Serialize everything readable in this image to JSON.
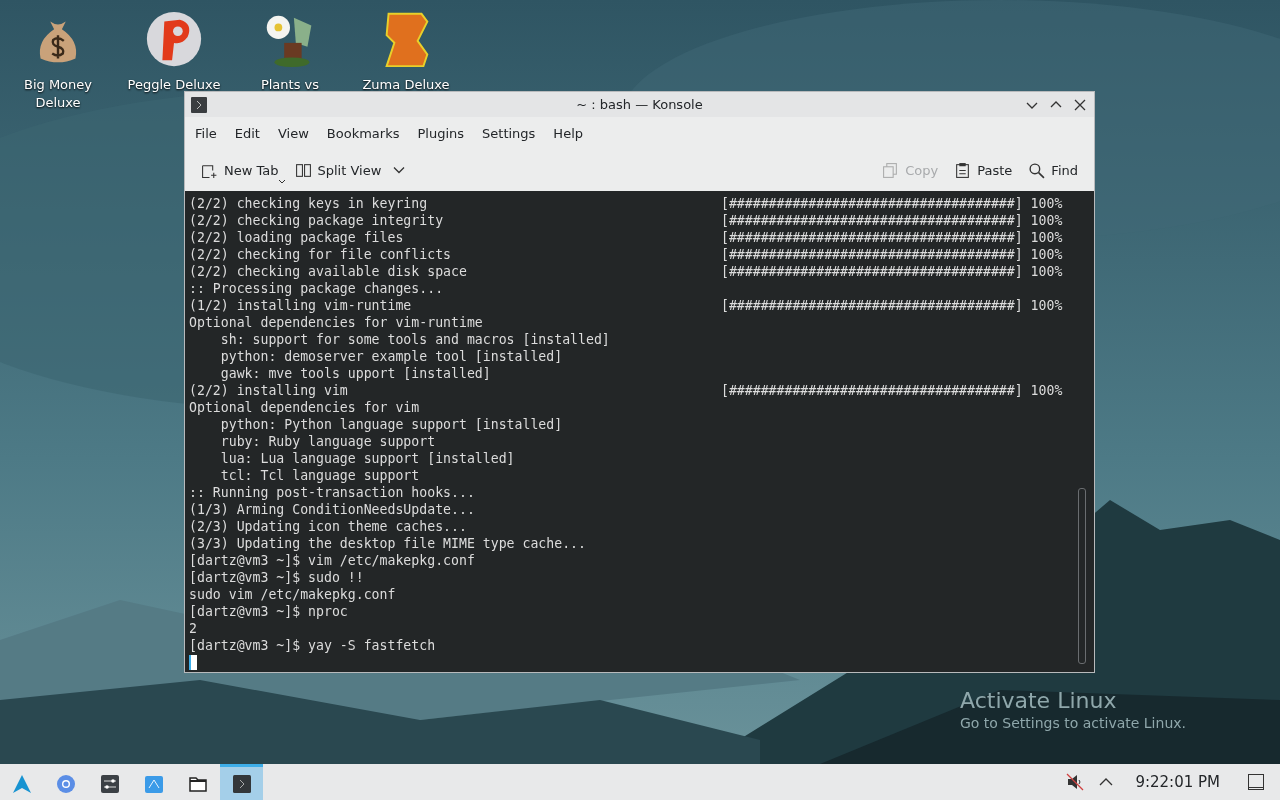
{
  "desktop_icons": [
    {
      "label": "Big Money Deluxe",
      "kind": "moneybag"
    },
    {
      "label": "Peggle Deluxe",
      "kind": "ball"
    },
    {
      "label": "Plants vs",
      "kind": "flower"
    },
    {
      "label": "Zuma Deluxe",
      "kind": "block"
    }
  ],
  "window": {
    "title": "~ : bash — Konsole",
    "menu": [
      "File",
      "Edit",
      "View",
      "Bookmarks",
      "Plugins",
      "Settings",
      "Help"
    ],
    "toolbar": [
      {
        "label": "New Tab",
        "kind": "new-tab",
        "disabled": false
      },
      {
        "label": "Split View",
        "kind": "split",
        "disabled": false
      },
      {
        "label": "Copy",
        "kind": "copy",
        "disabled": true
      },
      {
        "label": "Paste",
        "kind": "paste",
        "disabled": false
      },
      {
        "label": "Find",
        "kind": "find",
        "disabled": false
      }
    ],
    "terminal": {
      "lines": [
        {
          "text": "(2/2) checking keys in keyring",
          "progress": "[####################################] 100%"
        },
        {
          "text": "(2/2) checking package integrity",
          "progress": "[####################################] 100%"
        },
        {
          "text": "(2/2) loading package files",
          "progress": "[####################################] 100%"
        },
        {
          "text": "(2/2) checking for file conflicts",
          "progress": "[####################################] 100%"
        },
        {
          "text": "(2/2) checking available disk space",
          "progress": "[####################################] 100%"
        },
        {
          "text": ":: Processing package changes..."
        },
        {
          "text": "(1/2) installing vim-runtime",
          "progress": "[####################################] 100%"
        },
        {
          "text": "Optional dependencies for vim-runtime"
        },
        {
          "text": "    sh: support for some tools and macros [installed]"
        },
        {
          "text": "    python: demoserver example tool [installed]"
        },
        {
          "text": "    gawk: mve tools upport [installed]"
        },
        {
          "text": "(2/2) installing vim",
          "progress": "[####################################] 100%"
        },
        {
          "text": "Optional dependencies for vim"
        },
        {
          "text": "    python: Python language support [installed]"
        },
        {
          "text": "    ruby: Ruby language support"
        },
        {
          "text": "    lua: Lua language support [installed]"
        },
        {
          "text": "    tcl: Tcl language support"
        },
        {
          "text": ":: Running post-transaction hooks..."
        },
        {
          "text": "(1/3) Arming ConditionNeedsUpdate..."
        },
        {
          "text": "(2/3) Updating icon theme caches..."
        },
        {
          "text": "(3/3) Updating the desktop file MIME type cache..."
        },
        {
          "text": "[dartz@vm3 ~]$ vim /etc/makepkg.conf"
        },
        {
          "text": "[dartz@vm3 ~]$ sudo !!"
        },
        {
          "text": "sudo vim /etc/makepkg.conf"
        },
        {
          "text": "[dartz@vm3 ~]$ nproc"
        },
        {
          "text": "2"
        },
        {
          "text": "[dartz@vm3 ~]$ yay -S fastfetch"
        }
      ]
    }
  },
  "activation_notice": {
    "title": "Activate Linux",
    "subtitle": "Go to Settings to activate Linux."
  },
  "taskbar": {
    "apps": [
      {
        "kind": "launcher",
        "selected": false
      },
      {
        "kind": "browser",
        "selected": false
      },
      {
        "kind": "settings",
        "selected": false
      },
      {
        "kind": "store",
        "selected": false
      },
      {
        "kind": "files",
        "selected": false
      },
      {
        "kind": "terminal",
        "selected": true
      }
    ],
    "clock": "9:22:01 PM"
  }
}
